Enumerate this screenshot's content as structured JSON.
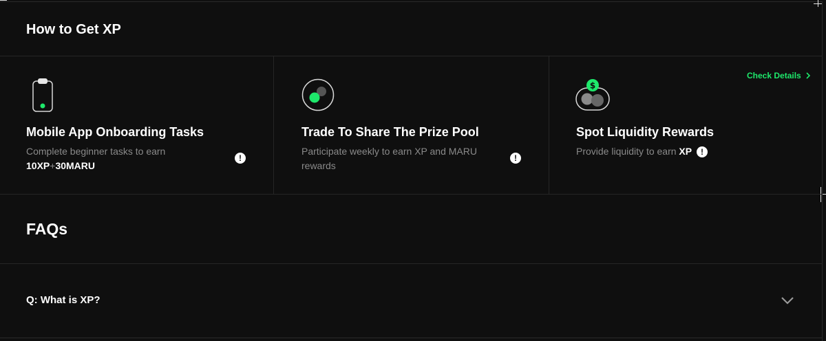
{
  "how_to": {
    "title": "How to Get XP",
    "check_details": "Check Details",
    "cards": [
      {
        "icon": "mobile-phone-icon",
        "title": "Mobile App Onboarding Tasks",
        "desc_prefix": "Complete beginner tasks to earn",
        "desc_bold_1": "10XP",
        "desc_plus": "+",
        "desc_bold_2": "30MARU"
      },
      {
        "icon": "prize-pool-icon",
        "title": "Trade To Share The Prize Pool",
        "desc": "Participate weekly to earn XP and MARU rewards"
      },
      {
        "icon": "liquidity-coins-icon",
        "title": "Spot Liquidity Rewards",
        "desc_prefix": "Provide liquidity to earn",
        "desc_bold": "XP"
      }
    ]
  },
  "faqs": {
    "title": "FAQs",
    "items": [
      {
        "question": "Q: What is XP?"
      }
    ]
  },
  "colors": {
    "background": "#0f0f0f",
    "accent_green": "#1ee86b",
    "muted_text": "#8a8a8a",
    "divider": "#262626"
  }
}
